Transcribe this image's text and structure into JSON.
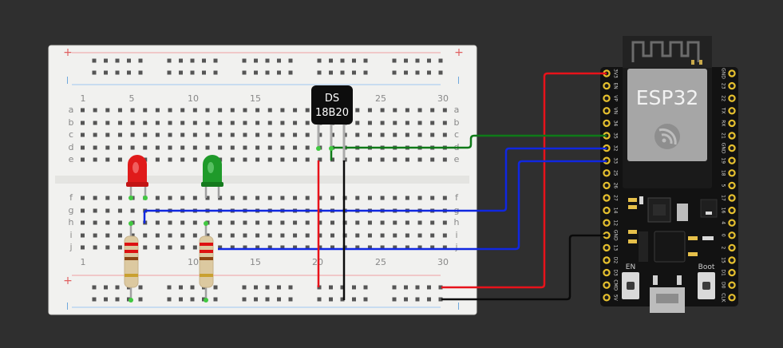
{
  "breadboard": {
    "column_numbers": [
      "1",
      "5",
      "10",
      "15",
      "20",
      "25",
      "30"
    ],
    "row_letters_top": [
      "a",
      "b",
      "c",
      "d",
      "e"
    ],
    "row_letters_bottom": [
      "f",
      "g",
      "h",
      "i",
      "j"
    ],
    "rail_plus": "+",
    "rail_minus": "-"
  },
  "sensor": {
    "line1": "DS",
    "line2": "18B20"
  },
  "leds": [
    {
      "color": "red",
      "hex": "#e01b1b"
    },
    {
      "color": "green",
      "hex": "#1f9a2a"
    }
  ],
  "board": {
    "title": "ESP32",
    "left_pins": [
      "3V3",
      "EN",
      "VP",
      "VN",
      "34",
      "35",
      "32",
      "33",
      "25",
      "26",
      "27",
      "14",
      "12",
      "GND",
      "13",
      "D2",
      "D3",
      "CMD",
      "5V"
    ],
    "right_pins": [
      "GND",
      "23",
      "22",
      "TX",
      "RX",
      "21",
      "GND",
      "19",
      "18",
      "5",
      "17",
      "16",
      "4",
      "0",
      "2",
      "15",
      "D1",
      "D0",
      "CLK"
    ],
    "buttons": {
      "en": "EN",
      "boot": "Boot"
    }
  },
  "wire_colors": {
    "power": "#e8121a",
    "ground": "#0a0a0a",
    "signal_data": "#0f7a18",
    "signal_led": "#1027e0"
  }
}
